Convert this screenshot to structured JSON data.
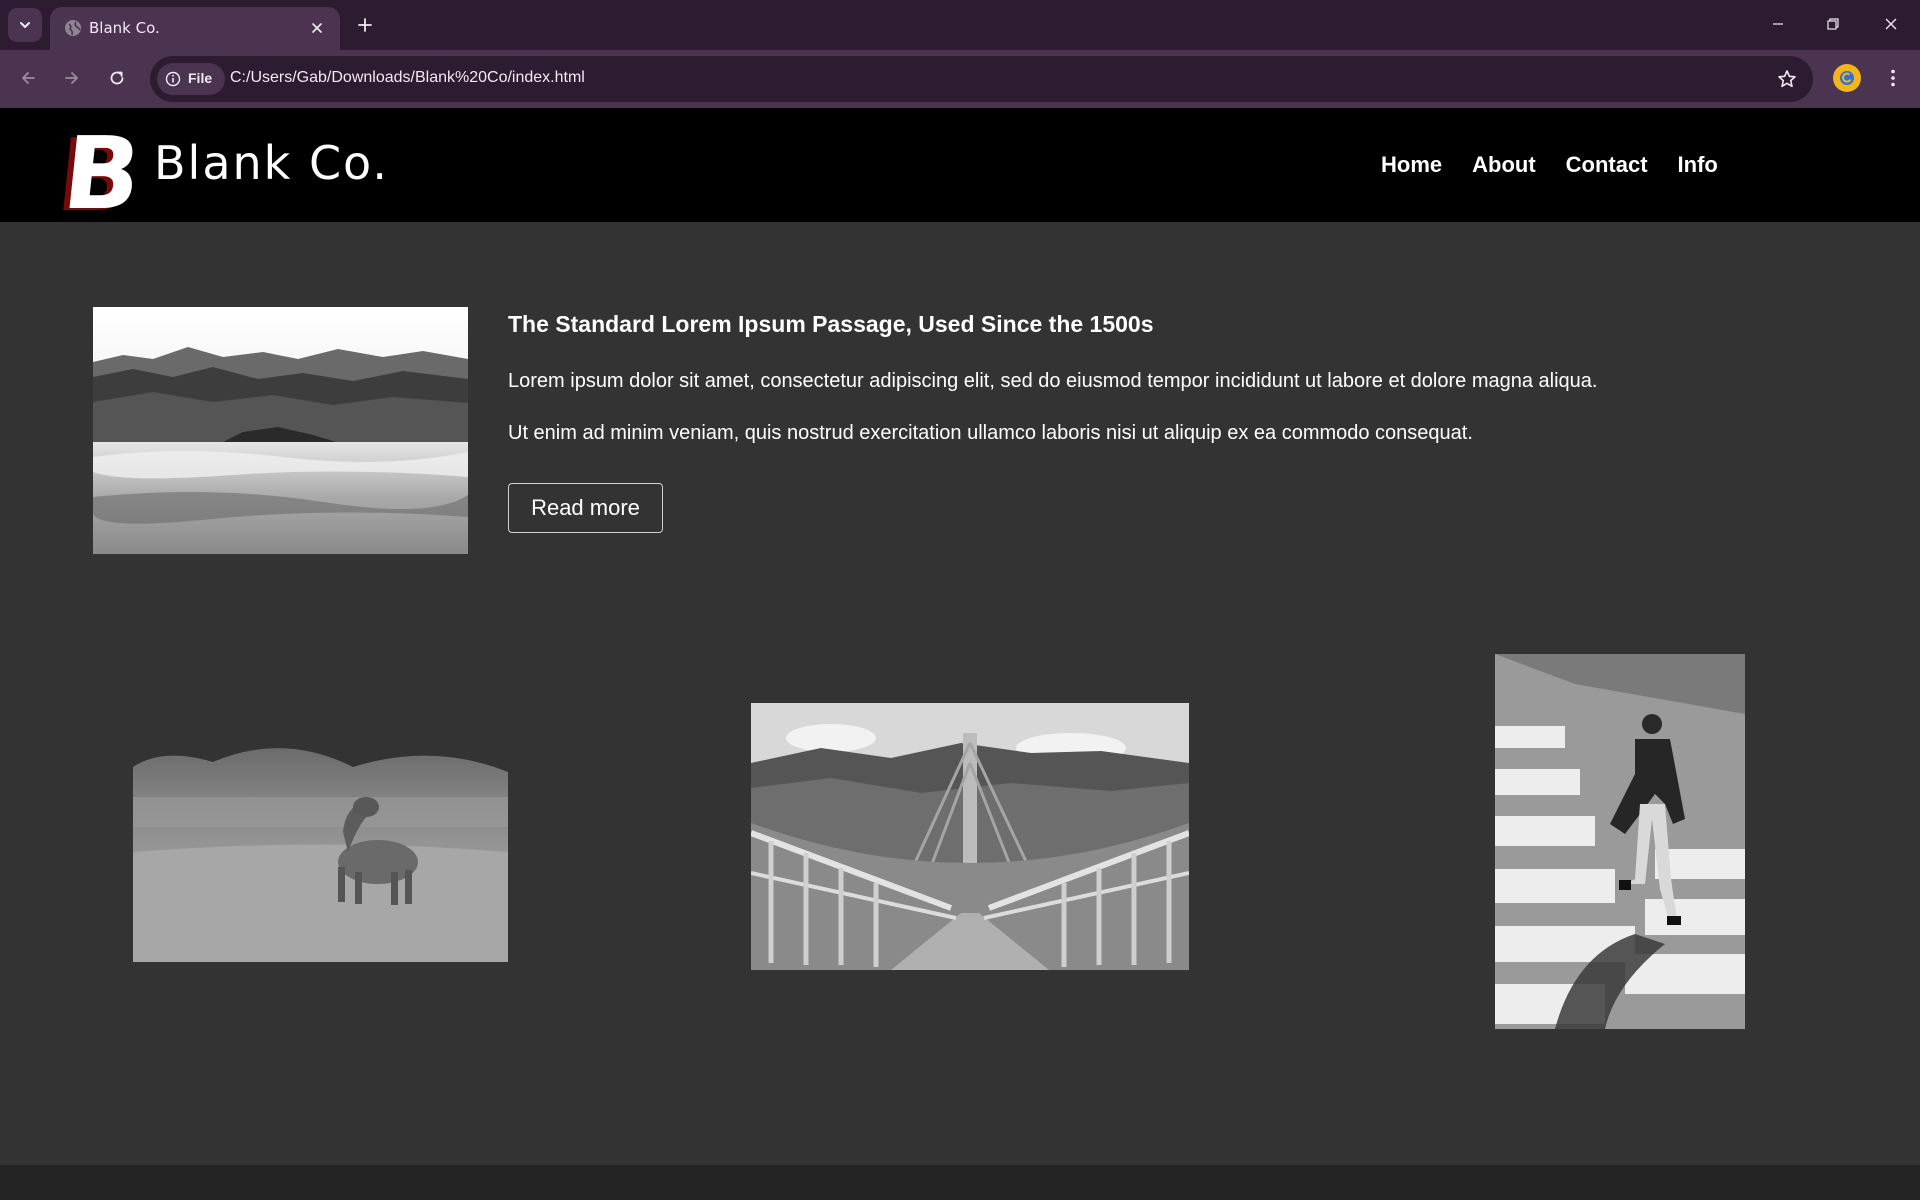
{
  "browser": {
    "tab_title": "Blank Co.",
    "site_chip_label": "File",
    "url": "C:/Users/Gab/Downloads/Blank%20Co/index.html"
  },
  "site": {
    "brand": "Blank Co.",
    "logo_letter": "B",
    "nav": [
      "Home",
      "About",
      "Contact",
      "Info"
    ]
  },
  "feature": {
    "title": "The Standard Lorem Ipsum Passage, Used Since the 1500s",
    "paragraphs": [
      "Lorem ipsum dolor sit amet, consectetur adipiscing elit, sed do eiusmod tempor incididunt ut labore et dolore magna aliqua.",
      "Ut enim ad minim veniam, quis nostrud exercitation ullamco laboris nisi ut aliquip ex ea commodo consequat."
    ],
    "button_label": "Read more"
  },
  "colors": {
    "tab_strip": "#2d1b31",
    "toolbar": "#4a3450",
    "header": "#000000",
    "page_bg": "#333333"
  },
  "icons": {
    "tab_search": "chevron-down-icon",
    "favicon": "globe-icon",
    "close_tab": "close-icon",
    "new_tab": "plus-icon",
    "minimize": "minimize-icon",
    "restore": "restore-icon",
    "close_window": "close-icon",
    "back": "back-arrow-icon",
    "forward": "forward-arrow-icon",
    "reload": "reload-icon",
    "info": "info-icon",
    "bookmark": "star-icon",
    "extension": "extension-icon",
    "menu": "kebab-menu-icon"
  }
}
